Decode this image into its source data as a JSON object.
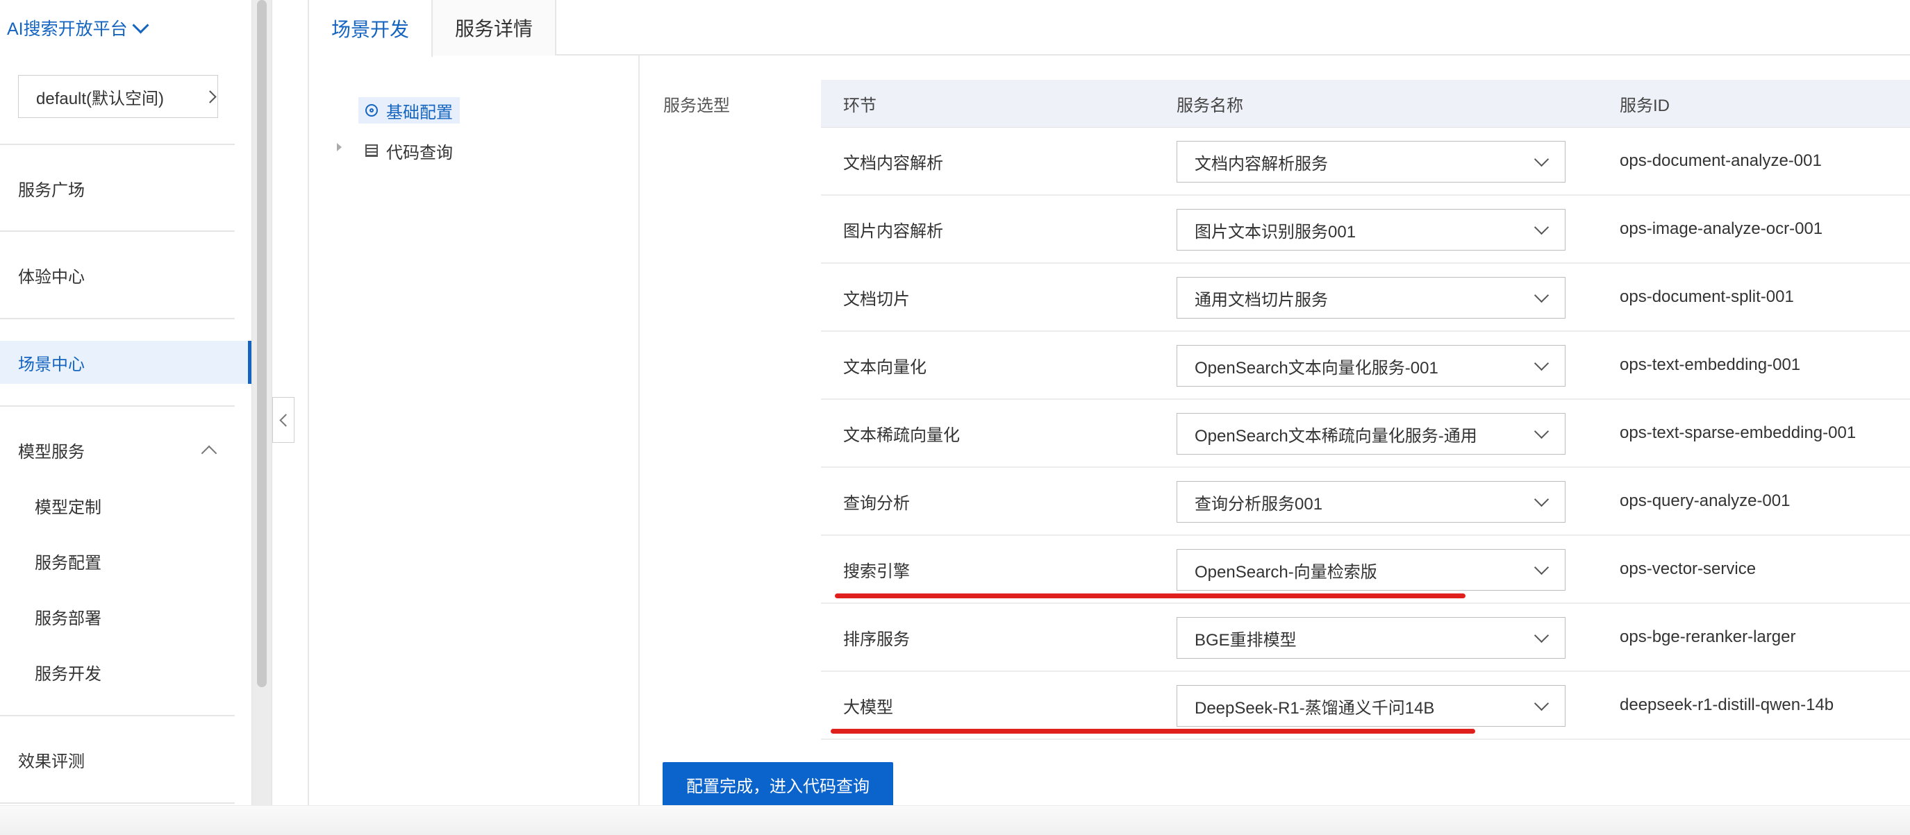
{
  "sidebar": {
    "platform_title": "AI搜索开放平台",
    "workspace_select": "default(默认空间)",
    "items": [
      {
        "label": "服务广场"
      },
      {
        "label": "体验中心"
      },
      {
        "label": "场景中心"
      },
      {
        "label": "模型服务"
      },
      {
        "label": "模型定制"
      },
      {
        "label": "服务配置"
      },
      {
        "label": "服务部署"
      },
      {
        "label": "服务开发"
      },
      {
        "label": "效果评测"
      }
    ]
  },
  "tabs": [
    {
      "label": "场景开发"
    },
    {
      "label": "服务详情"
    }
  ],
  "tree": {
    "items": [
      {
        "label": "基础配置"
      },
      {
        "label": "代码查询"
      }
    ]
  },
  "main": {
    "section_label": "服务选型",
    "table": {
      "headers": [
        "环节",
        "服务名称",
        "服务ID"
      ],
      "rows": [
        {
          "stage": "文档内容解析",
          "service": "文档内容解析服务",
          "id": "ops-document-analyze-001"
        },
        {
          "stage": "图片内容解析",
          "service": "图片文本识别服务001",
          "id": "ops-image-analyze-ocr-001"
        },
        {
          "stage": "文档切片",
          "service": "通用文档切片服务",
          "id": "ops-document-split-001"
        },
        {
          "stage": "文本向量化",
          "service": "OpenSearch文本向量化服务-001",
          "id": "ops-text-embedding-001"
        },
        {
          "stage": "文本稀疏向量化",
          "service": "OpenSearch文本稀疏向量化服务-通用",
          "id": "ops-text-sparse-embedding-001"
        },
        {
          "stage": "查询分析",
          "service": "查询分析服务001",
          "id": "ops-query-analyze-001"
        },
        {
          "stage": "搜索引擎",
          "service": "OpenSearch-向量检索版",
          "id": "ops-vector-service"
        },
        {
          "stage": "排序服务",
          "service": "BGE重排模型",
          "id": "ops-bge-reranker-larger"
        },
        {
          "stage": "大模型",
          "service": "DeepSeek-R1-蒸馏通义千问14B",
          "id": "deepseek-r1-distill-qwen-14b"
        }
      ]
    },
    "primary_button": "配置完成，进入代码查询"
  },
  "colors": {
    "accent": "#1565c0",
    "button": "#0b63cc",
    "annotation_red": "#e0201c"
  }
}
